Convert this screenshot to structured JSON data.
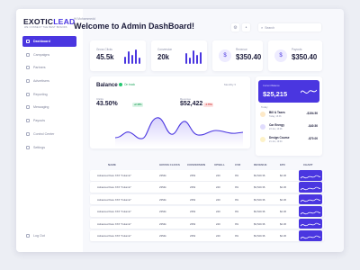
{
  "brand": {
    "name_part1": "EXOTIC",
    "name_part2": "LEAD",
    "tagline": "WE CONNECT THE BEST BRANDS"
  },
  "sidebar": {
    "items": [
      {
        "label": "Dashboard",
        "icon": "grid-icon",
        "active": true
      },
      {
        "label": "Campaigns",
        "icon": "megaphone-icon"
      },
      {
        "label": "Partners",
        "icon": "users-icon"
      },
      {
        "label": "Advertisers",
        "icon": "briefcase-icon"
      },
      {
        "label": "Reporting",
        "icon": "chart-icon"
      },
      {
        "label": "Messaging",
        "icon": "message-icon"
      },
      {
        "label": "Payouts",
        "icon": "wallet-icon"
      },
      {
        "label": "Control Center",
        "icon": "sliders-icon"
      },
      {
        "label": "Settings",
        "icon": "gear-icon"
      }
    ],
    "logout_label": "Log Out"
  },
  "header": {
    "greeting": "Hi Mohammedd",
    "title": "Welcome to Admin DashBoard!",
    "search_placeholder": "Search"
  },
  "stats": [
    {
      "label": "Gross Clicks",
      "value": "45.5k"
    },
    {
      "label": "Conversion",
      "value": "20k"
    },
    {
      "label": "Revenue",
      "value": "$350.40"
    },
    {
      "label": "Payouts",
      "value": "$350.40"
    }
  ],
  "balance": {
    "title": "Balance",
    "status": "On track",
    "period": "Monthly",
    "metric1_label": "Clicks",
    "metric1_value": "43.50%",
    "metric1_change": "+2.45%",
    "metric2_label": "Revenue",
    "metric2_value": "$52,422",
    "metric2_change": "-4.75%"
  },
  "card": {
    "label": "Current Balance",
    "value": "$25,215"
  },
  "payments": {
    "title": "Today",
    "items": [
      {
        "name": "Bill & Taxes",
        "date": "Today, 16:36",
        "amount": "-$154.50",
        "color": "#f5a623"
      },
      {
        "name": "Car Energy",
        "date": "23 Jun, 13:06",
        "amount": "-$40.50",
        "color": "#4a36e0"
      },
      {
        "name": "Design Course",
        "date": "21 Jun, 19:04",
        "amount": "-$70.00",
        "color": "#f2c94c"
      }
    ]
  },
  "table": {
    "headers": [
      "NAME",
      "GROSS CLICKS",
      "CONVERSION",
      "UPSELL",
      "CVR",
      "REVENUE",
      "EPC",
      "CHART"
    ],
    "rows": [
      [
        "Advanced Keto XXX \"Fulumin\"",
        "2354k",
        "2352",
        "240",
        "9%",
        "$3,520.36",
        "$2.36"
      ],
      [
        "Advanced Keto XXX \"Fulumin\"",
        "2354k",
        "2352",
        "240",
        "9%",
        "$3,520.36",
        "$2.36"
      ],
      [
        "Advanced Keto XXX \"Fulumin\"",
        "2354k",
        "2352",
        "240",
        "9%",
        "$3,520.36",
        "$2.36"
      ],
      [
        "Advanced Keto XXX \"Fulumin\"",
        "2354k",
        "2352",
        "240",
        "9%",
        "$3,520.36",
        "$2.36"
      ],
      [
        "Advanced Keto XXX \"Fulumin\"",
        "2354k",
        "2352",
        "240",
        "9%",
        "$3,520.36",
        "$2.36"
      ],
      [
        "Advanced Keto XXX \"Fulumin\"",
        "2354k",
        "2352",
        "240",
        "9%",
        "$3,520.36",
        "$2.36"
      ]
    ]
  },
  "colors": {
    "accent": "#4a36e0",
    "positive": "#22c76f",
    "negative": "#d23b3b"
  }
}
